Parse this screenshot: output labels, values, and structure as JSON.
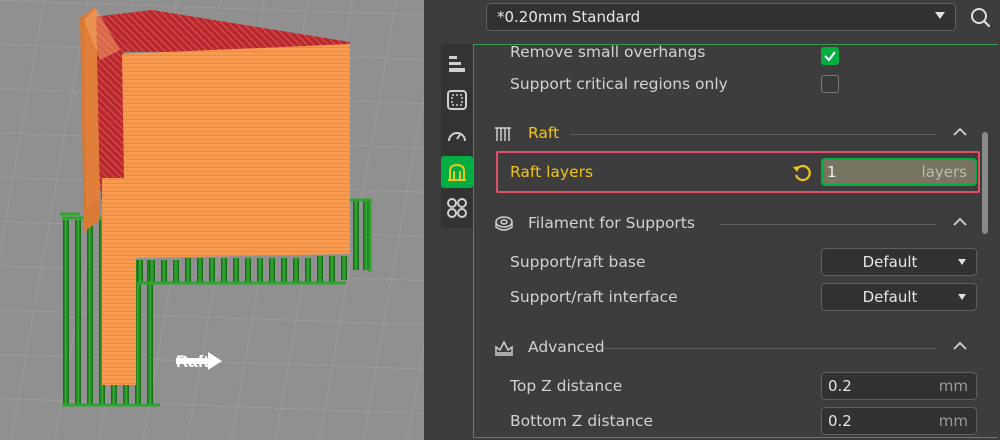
{
  "viewport": {
    "annotation_label": "Raft"
  },
  "preset": {
    "value": "*0.20mm Standard"
  },
  "sidetabs": [
    {
      "icon": "quality-icon",
      "active": false
    },
    {
      "icon": "strength-icon",
      "active": false
    },
    {
      "icon": "speed-icon",
      "active": false
    },
    {
      "icon": "support-icon",
      "active": true
    },
    {
      "icon": "others-icon",
      "active": false
    }
  ],
  "settings": {
    "remove_small_overhangs": {
      "label": "Remove small overhangs",
      "checked": true
    },
    "support_critical_only": {
      "label": "Support critical regions only",
      "checked": false
    },
    "raft_section": {
      "title": "Raft"
    },
    "raft_layers": {
      "label": "Raft layers",
      "value": "1",
      "unit": "layers"
    },
    "filament_section": {
      "title": "Filament for Supports"
    },
    "support_raft_base": {
      "label": "Support/raft base",
      "value": "Default"
    },
    "support_raft_interface": {
      "label": "Support/raft interface",
      "value": "Default"
    },
    "advanced_section": {
      "title": "Advanced"
    },
    "top_z_distance": {
      "label": "Top Z distance",
      "value": "0.2",
      "unit": "mm"
    },
    "bottom_z_distance": {
      "label": "Bottom Z distance",
      "value": "0.2",
      "unit": "mm"
    }
  },
  "colors": {
    "accent_green": "#00ae42",
    "highlight_red": "#e0506a",
    "section_title_yellow": "#f0c419",
    "model_orange": "#f79a50",
    "model_top_red": "#c8393c",
    "raft_green": "#1f8a1f"
  }
}
